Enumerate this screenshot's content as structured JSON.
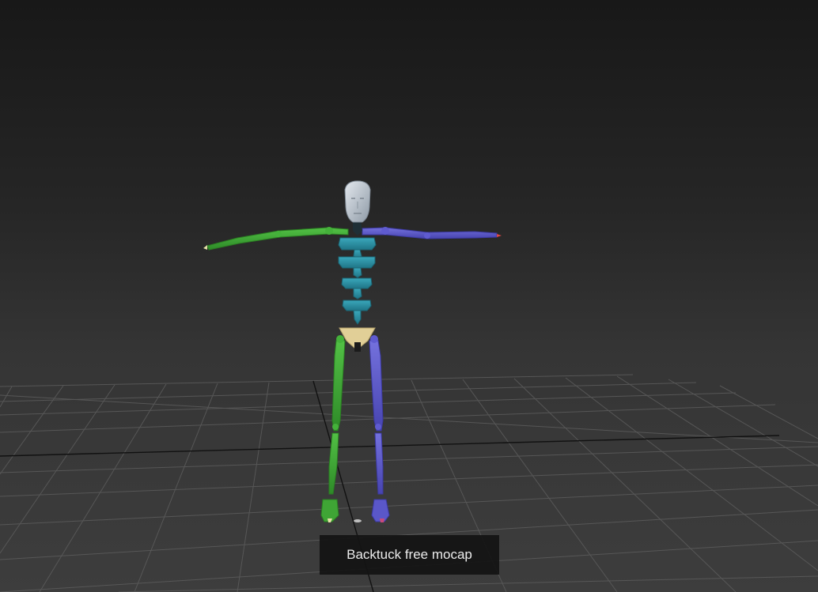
{
  "viewport": {
    "caption": "Backtuck free mocap"
  },
  "colors": {
    "background_top": "#181818",
    "background_bottom": "#3d3d3d",
    "grid_line": "#5c5c5c",
    "grid_axis": "#111111",
    "head": "#b9c3cc",
    "spine": "#2b8fa3",
    "pelvis": "#e1cf97",
    "left_limb": "#3fa535",
    "right_limb": "#5a57c9"
  }
}
